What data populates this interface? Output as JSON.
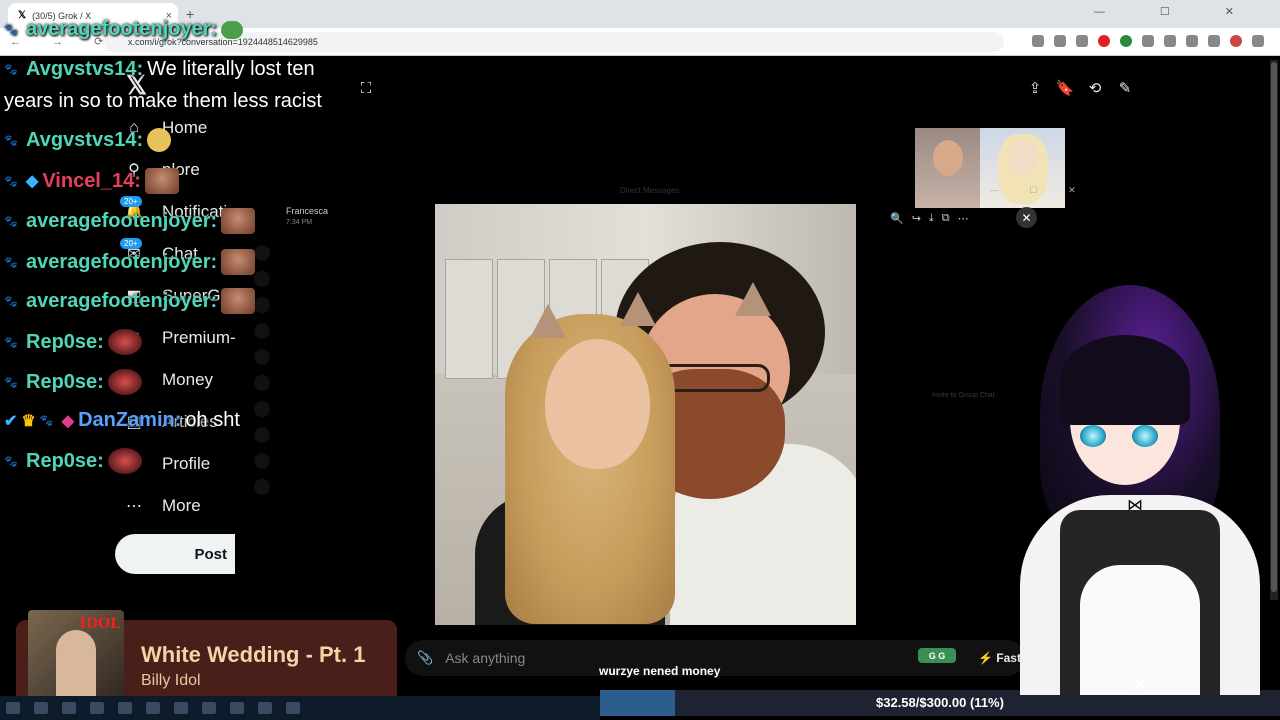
{
  "browser": {
    "tab_title": "(30/5) Grok / X",
    "url": "x.com/i/grok?conversation=1924448514629985",
    "new_tab": "+",
    "close_tab": "×",
    "window_controls": "— ☐ ✕",
    "nav_buttons": "← → ⟳"
  },
  "sidebar": {
    "items": [
      {
        "label": "Home",
        "icon": "home-icon",
        "glyph": "⌂"
      },
      {
        "label": "plore",
        "icon": "search-icon",
        "glyph": "⚲"
      },
      {
        "label": "Notificati",
        "icon": "bell-icon",
        "glyph": "🔔"
      },
      {
        "label": "Chat",
        "icon": "chat-icon",
        "glyph": "✉"
      },
      {
        "label": "SuperGr",
        "icon": "grok-icon",
        "glyph": "◩"
      },
      {
        "label": "Premium-",
        "icon": "x-premium-icon",
        "glyph": "✕"
      },
      {
        "label": "Money",
        "icon": "money-icon",
        "glyph": "$"
      },
      {
        "label": "Articles",
        "icon": "articles-icon",
        "glyph": "▤"
      },
      {
        "label": "Profile",
        "icon": "profile-icon",
        "glyph": "☺"
      },
      {
        "label": "More",
        "icon": "more-icon",
        "glyph": "⋯"
      }
    ],
    "badge_notif": "20+",
    "badge_chat": "20+",
    "post_label": "Post"
  },
  "dm": {
    "name": "Francesca",
    "time": "7:34 PM",
    "faint_header": "Direct Messages",
    "group_hint": "Invite to Group Chat"
  },
  "chat": {
    "lines": [
      {
        "user": "averagefootenjoyer:",
        "color": "#4fd6b8",
        "emote": "frog",
        "msg": ""
      },
      {
        "user": "Avgvstvs14:",
        "color": "#4fd6b8",
        "emote": "",
        "msg": "We literally lost ten"
      },
      {
        "user": "Avgvstvs14:",
        "color": "#4fd6b8",
        "emote": "emoji",
        "msg": ""
      },
      {
        "user": "Vincel_14:",
        "color": "#e83f5b",
        "emote": "face",
        "msg": ""
      },
      {
        "user": "averagefootenjoyer:",
        "color": "#4fd6b8",
        "emote": "face",
        "msg": ""
      },
      {
        "user": "averagefootenjoyer:",
        "color": "#4fd6b8",
        "emote": "face",
        "msg": ""
      },
      {
        "user": "averagefootenjoyer:",
        "color": "#4fd6b8",
        "emote": "face",
        "msg": ""
      },
      {
        "user": "Rep0se:",
        "color": "#4fd6b8",
        "emote": "lips",
        "msg": ""
      },
      {
        "user": "Rep0se:",
        "color": "#4fd6b8",
        "emote": "lips",
        "msg": ""
      },
      {
        "user": "DanZamin:",
        "color": "#5aa0ff",
        "emote": "",
        "msg": "oh sht"
      },
      {
        "user": "Rep0se:",
        "color": "#4fd6b8",
        "emote": "lips",
        "msg": ""
      }
    ],
    "continuation": "years in so to make them less racist"
  },
  "viewer": {
    "zoom": "🔍",
    "share": "↪",
    "download": "⤓",
    "open": "⧉",
    "more": "⋯",
    "close": "✕",
    "mini_controls": "— ☐ ✕"
  },
  "grok": {
    "expand_icon": "⛶",
    "top_icons": [
      "⇪",
      "🔖",
      "⟲",
      "✎"
    ],
    "ask_placeholder": "Ask anything",
    "attach_icon": "📎",
    "mode": "Fast",
    "mode_icon": "⚡",
    "badge_label": "G G"
  },
  "overlay": {
    "subtitle": "wurzye nened money",
    "donation_text": "$32.58/$300.00 (11%)",
    "donation_progress": 0.11,
    "vt_close": "✕"
  },
  "now_playing": {
    "title": "White Wedding - Pt. 1",
    "artist": "Billy Idol",
    "album_logo": "IDOL"
  }
}
